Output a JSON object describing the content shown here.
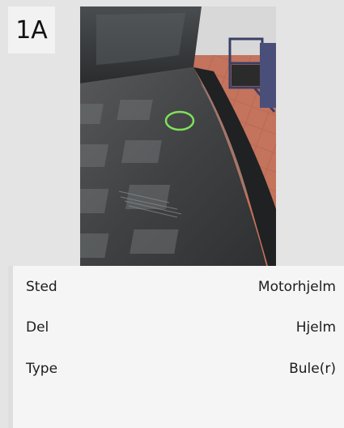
{
  "damage_card": {
    "badge": "1A",
    "photo": {
      "icon": "car-hood-dent-photo",
      "marker_color": "#7fe05a"
    },
    "details": [
      {
        "label": "Sted",
        "value": "Motorhjelm"
      },
      {
        "label": "Del",
        "value": "Hjelm"
      },
      {
        "label": "Type",
        "value": "Bule(r)"
      }
    ]
  }
}
